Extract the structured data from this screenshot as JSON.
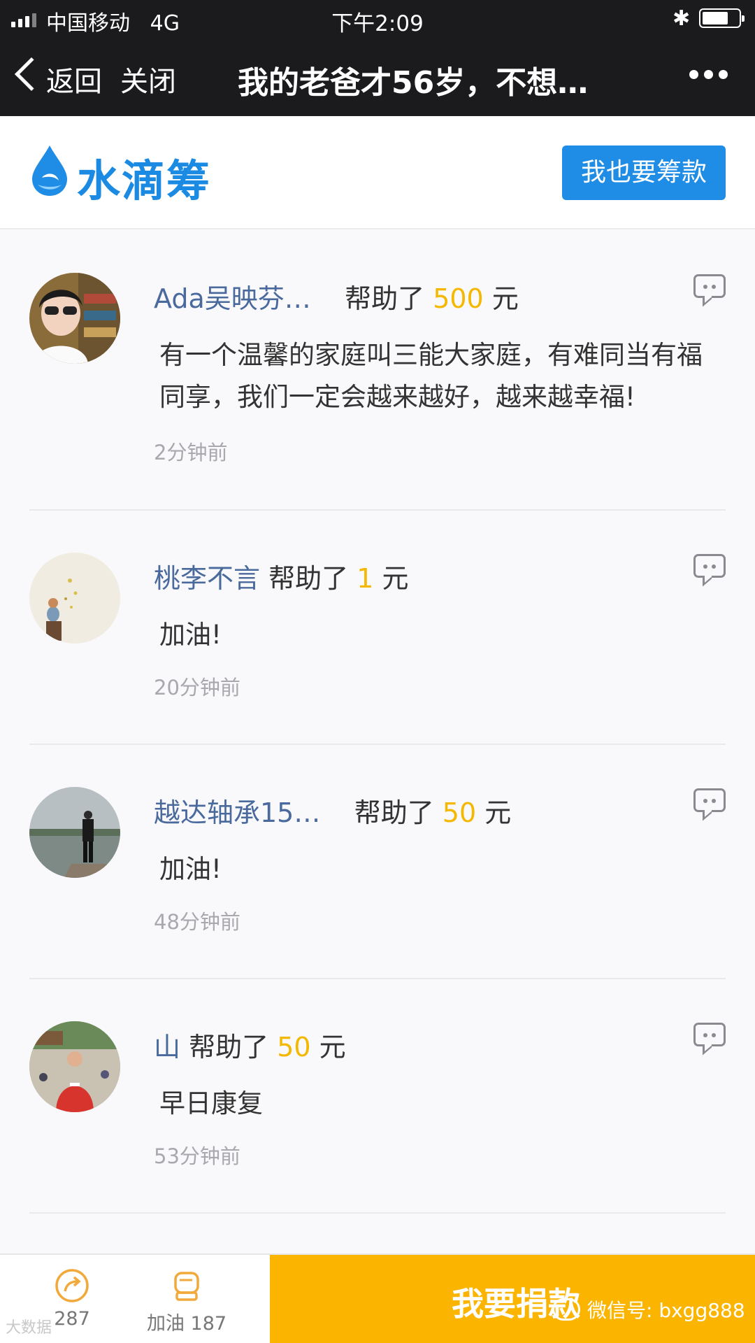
{
  "status_bar": {
    "carrier": "中国移动",
    "network": "4G",
    "time": "下午2:09",
    "bluetooth": "✱"
  },
  "nav": {
    "back": "返回",
    "close": "关闭",
    "title": "我的老爸才56岁，不想…"
  },
  "brand": {
    "name": "水滴筹",
    "raise_button": "我也要筹款",
    "color": "#1f8ce6"
  },
  "comments": [
    {
      "name": "Ada吴映芬…",
      "helped": "帮助了",
      "amount": "500",
      "unit": "元",
      "message": "有一个温馨的家庭叫三能大家庭，有难同当有福同享，我们一定会越来越好，越来越幸福!",
      "time": "2分钟前"
    },
    {
      "name": "桃李不言",
      "helped": "帮助了",
      "amount": "1",
      "unit": "元",
      "message": "加油!",
      "time": "20分钟前"
    },
    {
      "name": "越达轴承15…",
      "helped": "帮助了",
      "amount": "50",
      "unit": "元",
      "message": "加油!",
      "time": "48分钟前"
    },
    {
      "name": "山",
      "helped": "帮助了",
      "amount": "50",
      "unit": "元",
      "message": "早日康复",
      "time": "53分钟前"
    }
  ],
  "bottom_bar": {
    "share_count": "287",
    "cheer_label": "加油 187",
    "donate_button": "我要捐款",
    "accent": "#fbb500"
  },
  "watermark": {
    "wechat": "微信号: bxgg888",
    "source": "大数据"
  }
}
